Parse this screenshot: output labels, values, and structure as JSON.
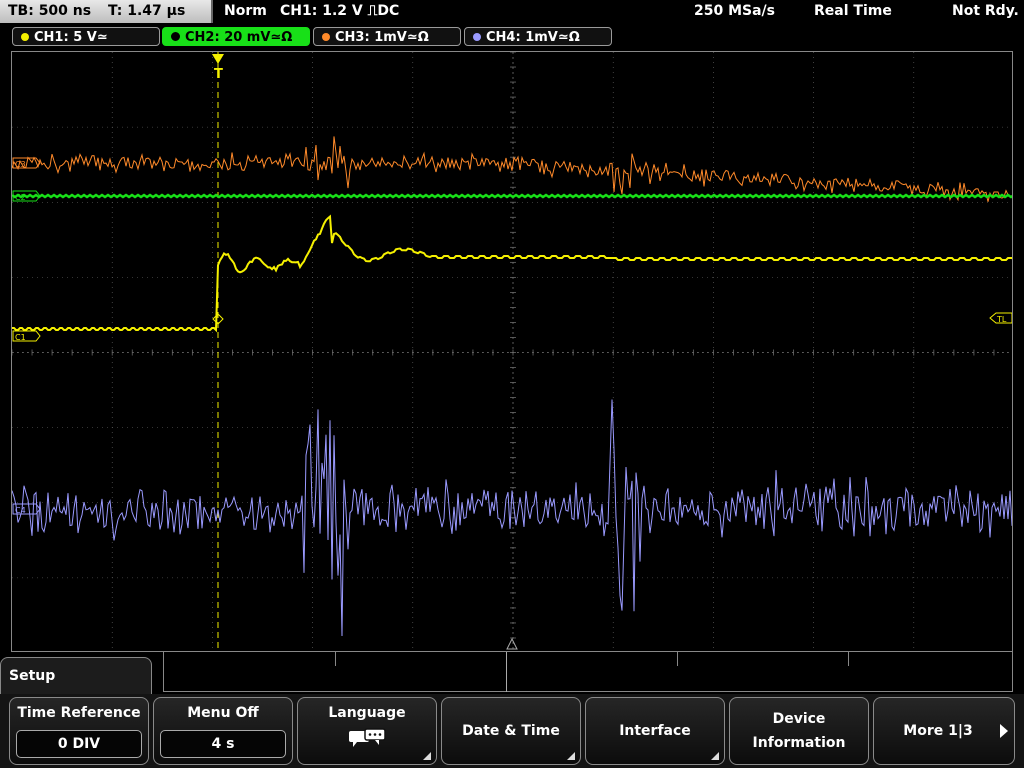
{
  "status": {
    "timebase": "TB: 500 ns",
    "trigger_time": "T: 1.47 µs",
    "mode": "Norm",
    "trigger_setting": "CH1: 1.2 V ⎍DC",
    "sample_rate": "250 MSa/s",
    "acq_mode": "Real Time",
    "ready_state": "Not Rdy."
  },
  "channels": [
    {
      "label": "CH1: 5 V≃",
      "color": "#f5f000",
      "active": false
    },
    {
      "label": "CH2: 20 mV≃Ω",
      "color": "#18e018",
      "active": true
    },
    {
      "label": "CH3: 1mV≃Ω",
      "color": "#ff8a2a",
      "active": false
    },
    {
      "label": "CH4: 1mV≃Ω",
      "color": "#9a9aff",
      "active": false
    }
  ],
  "markers": {
    "trigger_level": "TL",
    "ch1_marker": "C1",
    "ch2_marker": "C2",
    "ch3_marker": "C3",
    "ch4_marker": "C4",
    "trigger_top": "T"
  },
  "menu": {
    "title": "Setup",
    "softkeys": [
      {
        "label": "Time Reference",
        "value": "0 DIV"
      },
      {
        "label": "Menu Off",
        "value": "4 s"
      },
      {
        "label": "Language",
        "icon": "speech-bubble-icon"
      },
      {
        "label": "Date & Time"
      },
      {
        "label": "Interface"
      },
      {
        "label": "Device\nInformation"
      },
      {
        "label": "More 1|3"
      }
    ]
  },
  "colors": {
    "ch1": "#f5f000",
    "ch2": "#18e018",
    "ch3": "#ff8a2a",
    "ch4": "#9a9aff",
    "grid": "#6a6a6a"
  }
}
